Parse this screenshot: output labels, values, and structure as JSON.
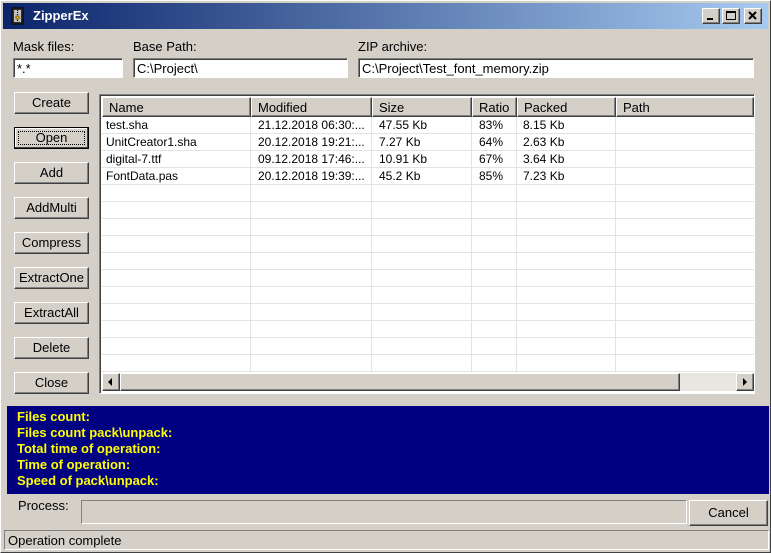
{
  "window": {
    "title": "ZipperEx",
    "minimize_label": "Minimize",
    "maximize_label": "Maximize",
    "close_label": "Close"
  },
  "fields": {
    "mask_label": "Mask files:",
    "mask_value": "*.*",
    "base_path_label": "Base Path:",
    "base_path_value": "C:\\Project\\",
    "zip_label": "ZIP archive:",
    "zip_value": "C:\\Project\\Test_font_memory.zip"
  },
  "buttons": {
    "create": "Create",
    "open": "Open",
    "add": "Add",
    "addmulti": "AddMulti",
    "compress": "Compress",
    "extractone": "ExtractOne",
    "extractall": "ExtractAll",
    "delete": "Delete",
    "close": "Close",
    "cancel": "Cancel"
  },
  "list": {
    "columns": [
      "Name",
      "Modified",
      "Size",
      "Ratio",
      "Packed",
      "Path"
    ],
    "rows": [
      [
        "test.sha",
        "21.12.2018 06:30:...",
        "47.55 Kb",
        "83%",
        "8.15 Kb",
        ""
      ],
      [
        "UnitCreator1.sha",
        "20.12.2018 19:21:...",
        "7.27 Kb",
        "64%",
        "2.63 Kb",
        ""
      ],
      [
        "digital-7.ttf",
        "09.12.2018 17:46:...",
        "10.91 Kb",
        "67%",
        "3.64 Kb",
        ""
      ],
      [
        "FontData.pas",
        "20.12.2018 19:39:...",
        "45.2 Kb",
        "85%",
        "7.23 Kb",
        ""
      ]
    ]
  },
  "info": {
    "files_count": "Files count:",
    "files_count_pack": "Files count pack\\unpack:",
    "total_time": "Total time of operation:",
    "time": "Time of operation:",
    "speed": "Speed of pack\\unpack:"
  },
  "process": {
    "label": "Process:",
    "progress": 0
  },
  "status": {
    "text": "Operation complete"
  },
  "colors": {
    "info_background": "#000080",
    "info_text": "#ffff00",
    "title_gradient_start": "#0a246a",
    "title_gradient_end": "#a6caf0"
  }
}
